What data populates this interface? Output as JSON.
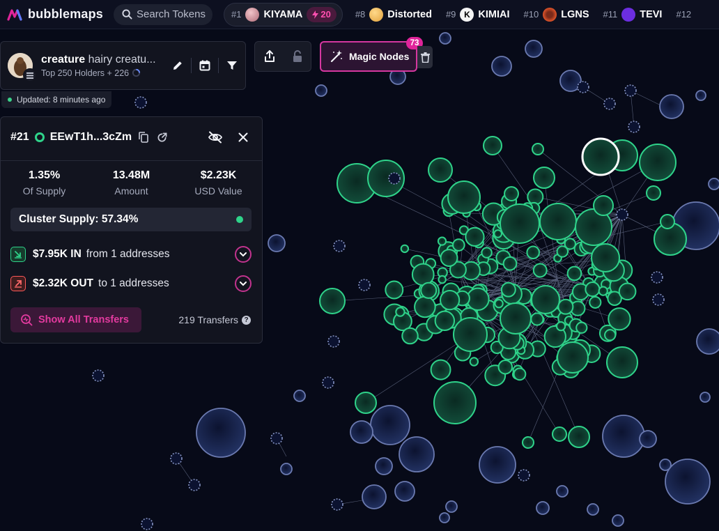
{
  "brand": {
    "name": "bubblemaps",
    "accent": "#e0249a",
    "green": "#2fd38a",
    "navy_bubble": "#1f2b55"
  },
  "search": {
    "placeholder": "Search Tokens"
  },
  "trending": {
    "active": {
      "rank": "#1",
      "name": "KIYAMA",
      "boost": "20"
    },
    "items": [
      {
        "rank": "#8",
        "name": "Distorted"
      },
      {
        "rank": "#9",
        "name": "KIMIAI"
      },
      {
        "rank": "#10",
        "name": "LGNS"
      },
      {
        "rank": "#11",
        "name": "TEVI"
      },
      {
        "rank": "#12",
        "name": ""
      }
    ]
  },
  "token": {
    "symbol": "creature",
    "name": "hairy creatu...",
    "scope": "Top 250 Holders + 226",
    "chain_icon": "solana-icon"
  },
  "updated": "Updated: 8 minutes ago",
  "magic_nodes": {
    "label": "Magic Nodes",
    "count": "73"
  },
  "wallet": {
    "rank": "#21",
    "address": "EEwT1h...3cZm",
    "stats": [
      {
        "value": "1.35%",
        "label": "Of Supply"
      },
      {
        "value": "13.48M",
        "label": "Amount"
      },
      {
        "value": "$2.23K",
        "label": "USD Value"
      }
    ],
    "cluster_supply": "Cluster Supply: 57.34%",
    "inflow": {
      "amount": "$7.95K IN",
      "detail": "from 1 addresses"
    },
    "outflow": {
      "amount": "$2.32K OUT",
      "detail": "to 1 addresses"
    },
    "show_all": "Show All Transfers",
    "transfers": "219 Transfers"
  }
}
